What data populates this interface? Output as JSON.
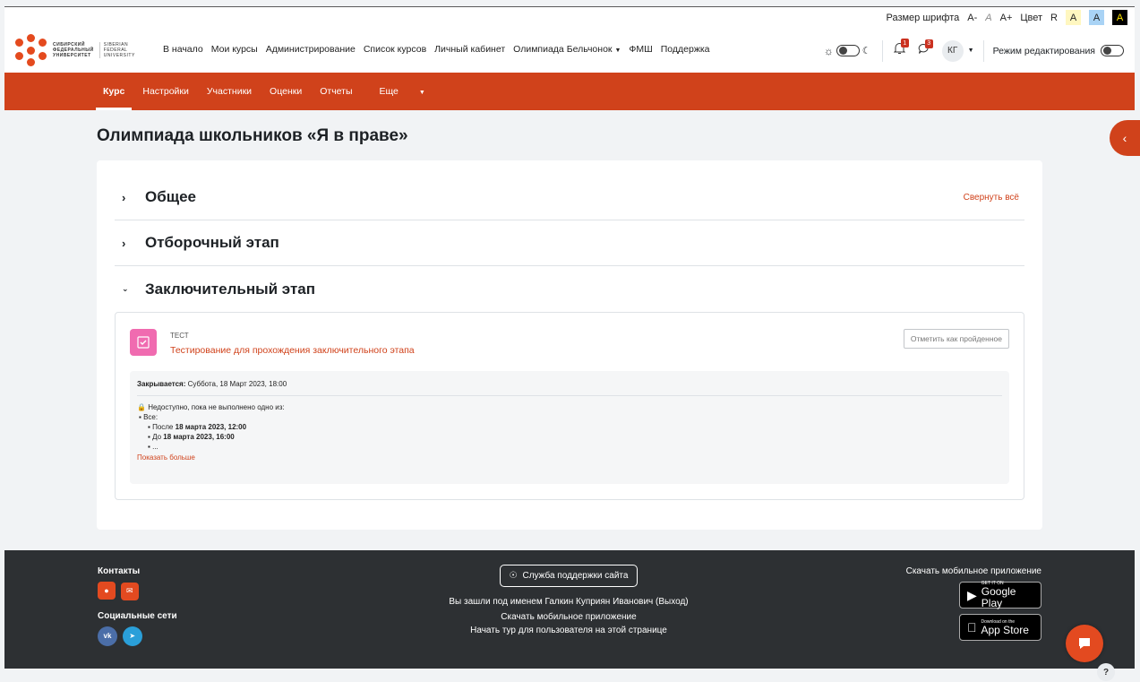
{
  "accessibility": {
    "font_size_label": "Размер шрифта",
    "font_minus": "A-",
    "font_normal": "A",
    "font_plus": "A+",
    "color_label": "Цвет",
    "color_reset": "R",
    "color_a1": "A",
    "color_a2": "A",
    "color_a3": "A"
  },
  "navbar": {
    "logo_line1": "СИБИРСКИЙ",
    "logo_line2": "ФЕДЕРАЛЬНЫЙ",
    "logo_line3": "УНИВЕРСИТЕТ",
    "logo_en1": "SIBERIAN",
    "logo_en2": "FEDERAL",
    "logo_en3": "UNIVERSITY",
    "links": [
      "В начало",
      "Мои курсы",
      "Администрирование",
      "Список курсов",
      "Личный кабинет",
      "Олимпиада Бельчонок",
      "ФМШ",
      "Поддержка"
    ],
    "notification_count": "1",
    "message_count": "3",
    "avatar_initials": "КГ",
    "edit_mode_label": "Режим редактирования"
  },
  "secondary_nav": [
    "Курс",
    "Настройки",
    "Участники",
    "Оценки",
    "Отчеты",
    "Еще"
  ],
  "course": {
    "title": "Олимпиада школьников «Я в праве»",
    "collapse_all": "Свернуть всё",
    "sections": [
      "Общее",
      "Отборочный этап",
      "Заключительный этап"
    ]
  },
  "activity": {
    "type": "ТЕСТ",
    "name": "Тестирование для прохождения заключительного этапа",
    "mark_button": "Отметить как пройденное",
    "closes_label": "Закрывается:",
    "closes_value": "Суббота, 18 Март 2023, 18:00",
    "restr_intro": "Недоступно, пока не выполнено одно из:",
    "restr_all": "Все:",
    "restr_after_prefix": "После",
    "restr_after_date": "18 марта 2023, 12:00",
    "restr_before_prefix": "До",
    "restr_before_date": "18 марта 2023, 16:00",
    "restr_ellipsis": "...",
    "show_more": "Показать больше"
  },
  "footer": {
    "contacts": "Контакты",
    "social": "Социальные сети",
    "vk": "vk",
    "support_button": "Служба поддержки сайта",
    "logged_in": "Вы зашли под именем Галкин Куприян Иванович (Выход)",
    "download_app": "Скачать мобильное приложение",
    "start_tour": "Начать тур для пользователя на этой странице",
    "download_app_right": "Скачать мобильное приложение",
    "gp_small": "GET IT ON",
    "gp_big": "Google Play",
    "as_small": "Download on the",
    "as_big": "App Store"
  },
  "help_label": "?"
}
